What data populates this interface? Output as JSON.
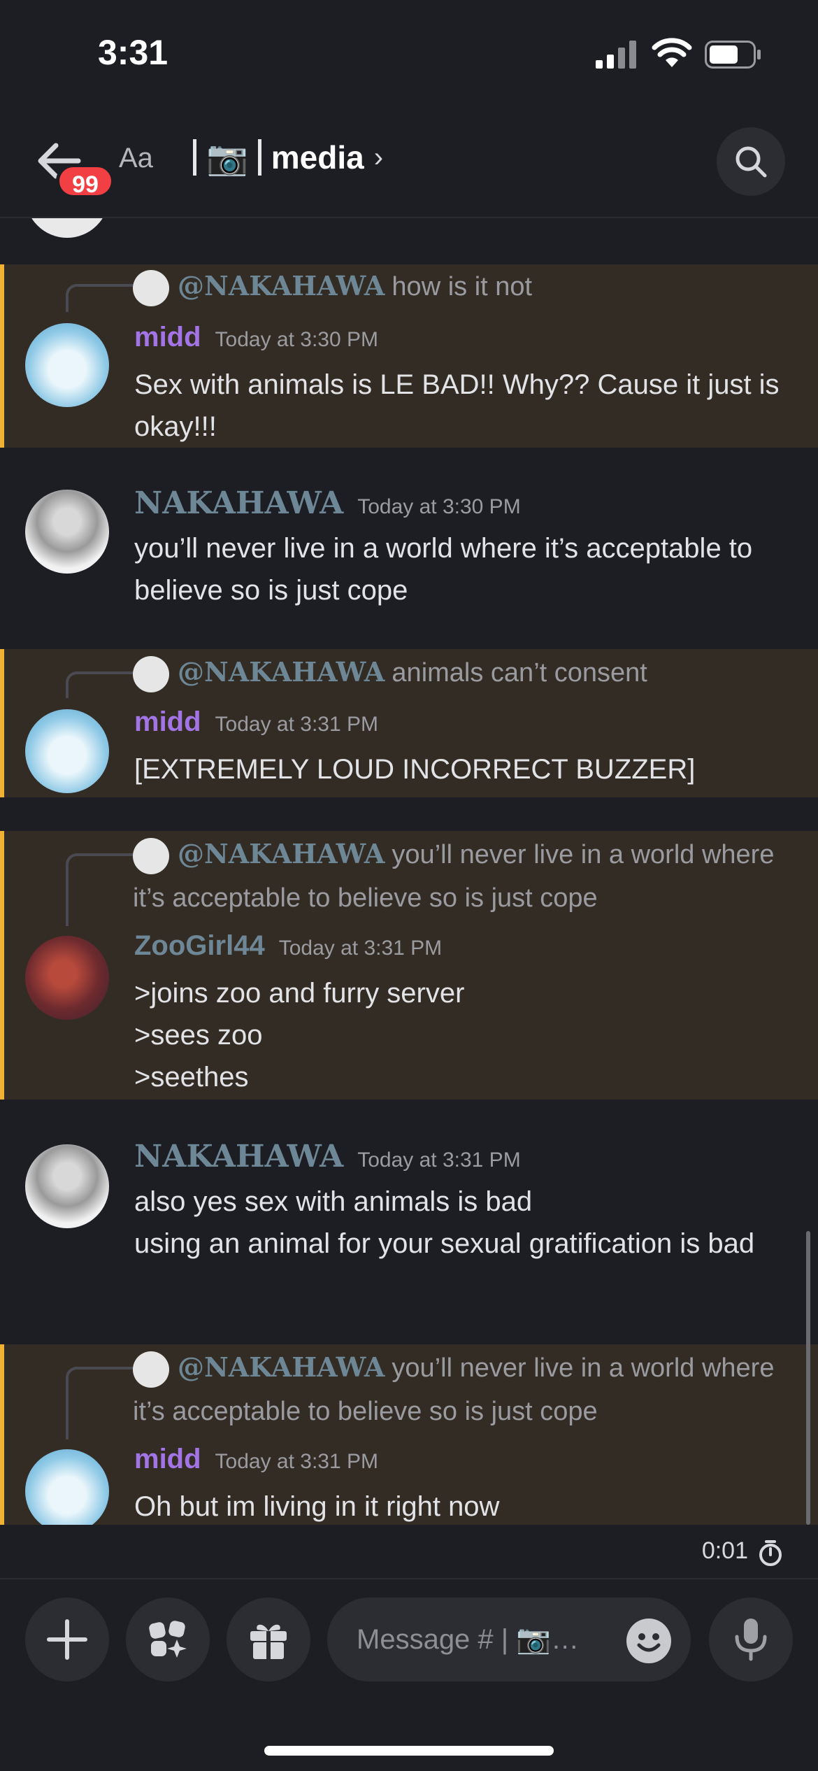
{
  "status_bar": {
    "time": "3:31"
  },
  "header": {
    "unread_badge": "99",
    "text_size_label": "Aa",
    "channel_emoji": "📷",
    "channel_name": "media",
    "chevron": "›"
  },
  "messages": [
    {
      "highlighted": true,
      "reply": {
        "mention": "@NAKAHAWA",
        "text": "how is it not"
      },
      "author": "midd",
      "timestamp": "Today at 3:30 PM",
      "body": "Sex with animals is LE BAD!! Why?? Cause it just is okay!!!"
    },
    {
      "highlighted": false,
      "author": "NAKAHAWA",
      "timestamp": "Today at 3:30 PM",
      "body": "you’ll never live in a world where it’s acceptable to believe so is just cope"
    },
    {
      "highlighted": true,
      "reply": {
        "mention": "@NAKAHAWA",
        "text": "animals can’t consent"
      },
      "author": "midd",
      "timestamp": "Today at 3:31 PM",
      "body": "[EXTREMELY LOUD INCORRECT BUZZER]"
    },
    {
      "highlighted": true,
      "reply": {
        "mention": "@NAKAHAWA",
        "text": "you’ll never live in a world where it’s acceptable to believe so is just cope"
      },
      "author": "ZooGirl44",
      "timestamp": "Today at 3:31 PM",
      "body": ">joins zoo and furry server\n>sees zoo\n>seethes"
    },
    {
      "highlighted": false,
      "author": "NAKAHAWA",
      "timestamp": "Today at 3:31 PM",
      "body": "also yes sex with animals is bad\nusing an animal for your sexual gratification is bad"
    },
    {
      "highlighted": true,
      "reply": {
        "mention": "@NAKAHAWA",
        "text": "you’ll never live in a world where it’s acceptable to believe so is just cope"
      },
      "author": "midd",
      "timestamp": "Today at 3:31 PM",
      "body": "Oh but im living in it right now"
    }
  ],
  "slowmode_timer": "0:01",
  "composer": {
    "placeholder": "Message # | 📷…"
  },
  "colors": {
    "background": "#1d1e24",
    "highlight_bg": "#332c24",
    "highlight_bar": "#f0b232",
    "author_purple": "#a374e6",
    "author_slate": "#6e8796",
    "badge_red": "#f23f43"
  },
  "icons": [
    "back-arrow-icon",
    "search-icon",
    "camera-icon",
    "plus-icon",
    "apps-icon",
    "gift-icon",
    "emoji-icon",
    "microphone-icon",
    "timer-icon"
  ]
}
